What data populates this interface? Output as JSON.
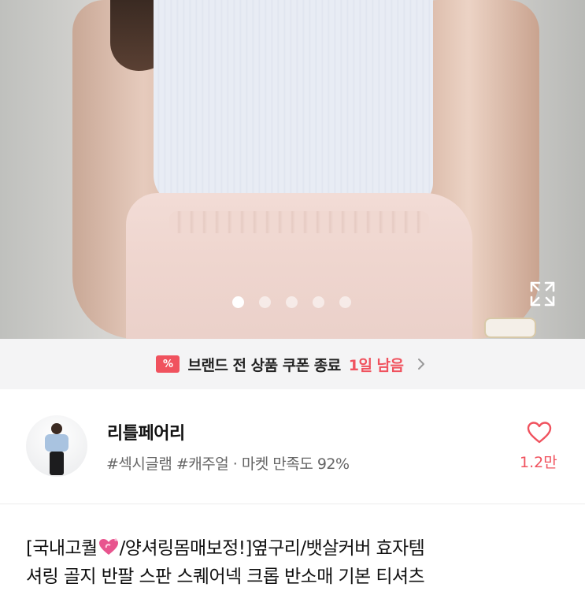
{
  "gallery": {
    "page_count": 5,
    "active_index": 0
  },
  "coupon": {
    "icon_label": "%",
    "text": "브랜드 전 상품 쿠폰 종료",
    "highlight": "1일 남음"
  },
  "shop": {
    "name": "리틀페어리",
    "tags": "#섹시글램 #캐주얼 · 마켓 만족도 92%",
    "like_count": "1.2만"
  },
  "product": {
    "title_before": "[국내고퀄",
    "title_after": "/양셔링몸매보정!]옆구리/뱃살커버 효자템",
    "title_line2": "셔링 골지 반팔 스판 스퀘어넥 크롭 반소매 기본 티셔츠"
  },
  "colors": {
    "accent": "#f0525e",
    "banner_bg": "#f4f4f5"
  }
}
